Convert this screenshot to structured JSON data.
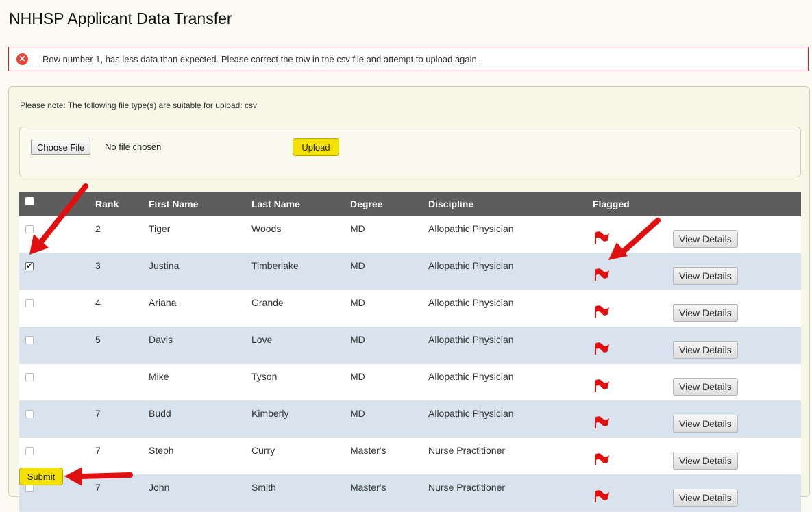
{
  "page": {
    "title": "NHHSP Applicant Data Transfer"
  },
  "error": {
    "message": "Row number 1, has less data than expected. Please correct the row in the csv file and attempt to upload again.",
    "icon": "error-x-icon",
    "color": "#e8473a"
  },
  "upload": {
    "note": "Please note: The following file type(s) are suitable for upload: csv",
    "choose_label": "Choose File",
    "file_status": "No file chosen",
    "upload_label": "Upload"
  },
  "table": {
    "headers": [
      "",
      "Rank",
      "First Name",
      "Last Name",
      "Degree",
      "Discipline",
      "Flagged",
      ""
    ],
    "view_label": "View Details",
    "rows": [
      {
        "checked": false,
        "rank": "2",
        "first": "Tiger",
        "last": "Woods",
        "degree": "MD",
        "discipline": "Allopathic Physician"
      },
      {
        "checked": true,
        "rank": "3",
        "first": "Justina",
        "last": "Timberlake",
        "degree": "MD",
        "discipline": "Allopathic Physician"
      },
      {
        "checked": false,
        "rank": "4",
        "first": "Ariana",
        "last": "Grande",
        "degree": "MD",
        "discipline": "Allopathic Physician"
      },
      {
        "checked": false,
        "rank": "5",
        "first": "Davis",
        "last": "Love",
        "degree": "MD",
        "discipline": "Allopathic Physician"
      },
      {
        "checked": false,
        "rank": "",
        "first": "Mike",
        "last": "Tyson",
        "degree": "MD",
        "discipline": "Allopathic Physician"
      },
      {
        "checked": false,
        "rank": "7",
        "first": "Budd",
        "last": "Kimberly",
        "degree": "MD",
        "discipline": "Allopathic Physician"
      },
      {
        "checked": false,
        "rank": "7",
        "first": "Steph",
        "last": "Curry",
        "degree": "Master's",
        "discipline": "Nurse Practitioner"
      },
      {
        "checked": false,
        "rank": "7",
        "first": "John",
        "last": "Smith",
        "degree": "Master's",
        "discipline": "Nurse Practitioner"
      }
    ]
  },
  "submit": {
    "label": "Submit"
  },
  "colors": {
    "header_bg": "#5d5d5d",
    "row_alt": "#d8e3ee",
    "accent_button": "#f5e100",
    "flag": "#e01010",
    "annotation_arrow": "#e01010"
  }
}
